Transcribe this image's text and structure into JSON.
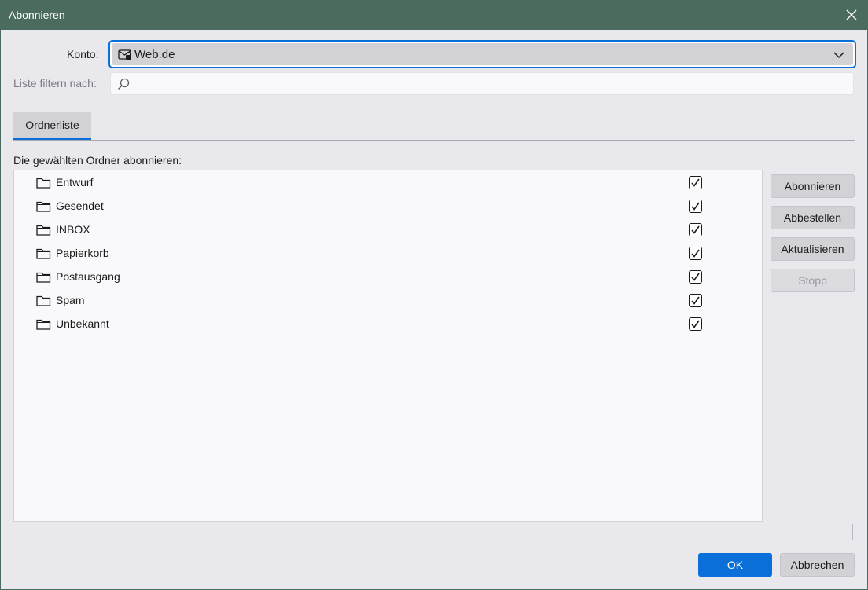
{
  "window": {
    "title": "Abonnieren"
  },
  "account": {
    "label": "Konto:",
    "selected": "Web.de"
  },
  "filter": {
    "label": "Liste filtern nach:",
    "value": "",
    "placeholder": ""
  },
  "tabs": [
    {
      "label": "Ordnerliste",
      "active": true
    }
  ],
  "list": {
    "heading": "Die gewählten Ordner abonnieren:",
    "folders": [
      {
        "name": "Entwurf",
        "subscribed": true
      },
      {
        "name": "Gesendet",
        "subscribed": true
      },
      {
        "name": "INBOX",
        "subscribed": true
      },
      {
        "name": "Papierkorb",
        "subscribed": true
      },
      {
        "name": "Postausgang",
        "subscribed": true
      },
      {
        "name": "Spam",
        "subscribed": true
      },
      {
        "name": "Unbekannt",
        "subscribed": true
      }
    ]
  },
  "actions": {
    "subscribe": "Abonnieren",
    "unsubscribe": "Abbestellen",
    "refresh": "Aktualisieren",
    "stop": "Stopp"
  },
  "footer": {
    "ok": "OK",
    "cancel": "Abbrechen"
  },
  "colors": {
    "titlebar": "#4a6b5e",
    "accent": "#0a6fd8"
  }
}
